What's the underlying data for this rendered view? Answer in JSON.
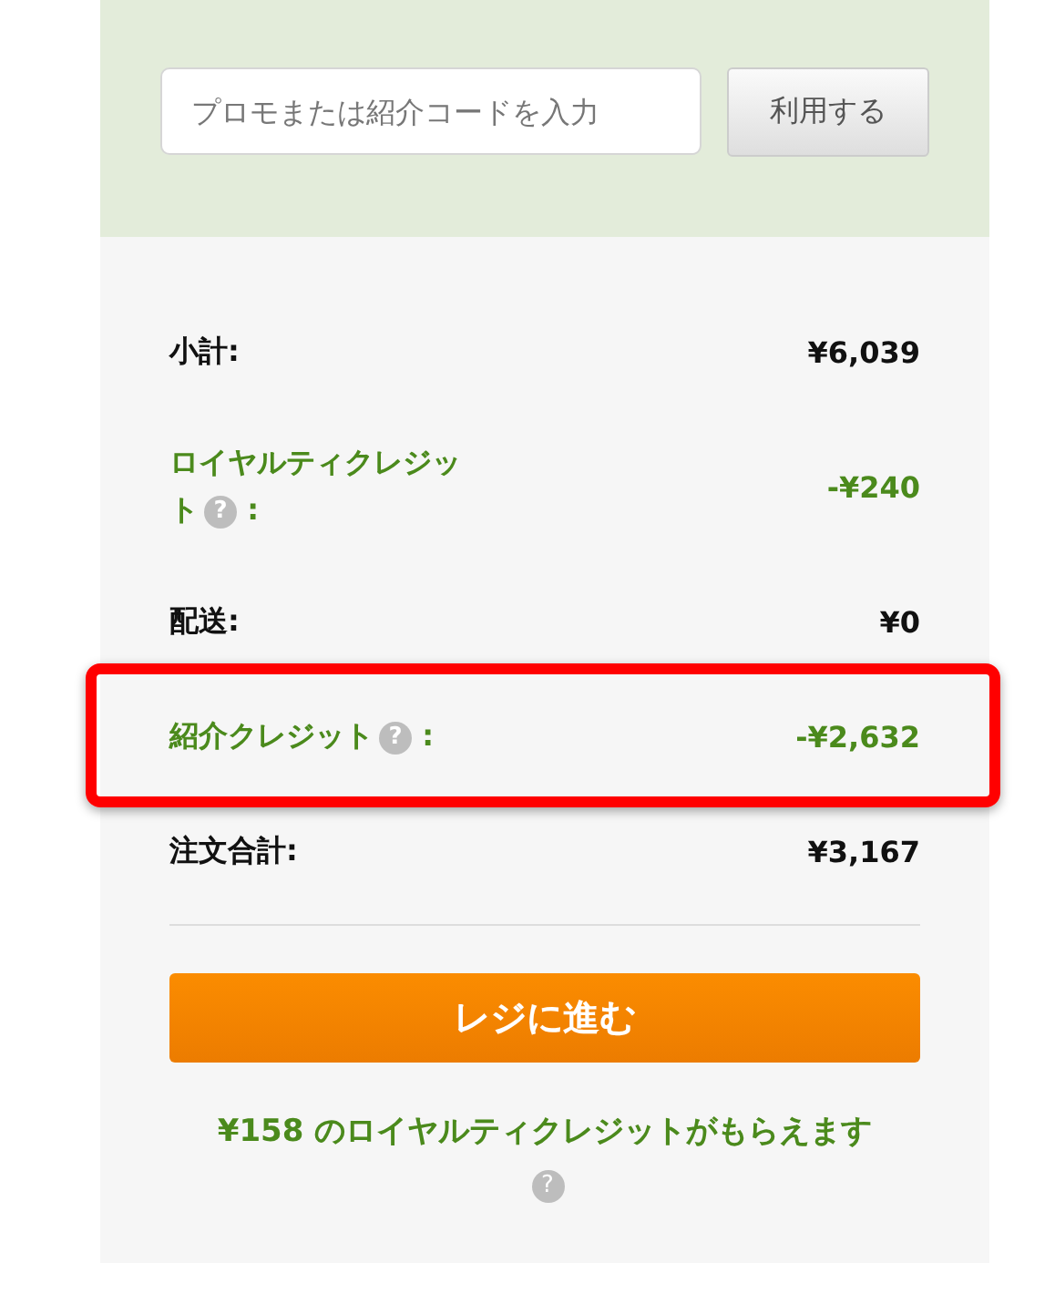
{
  "promo": {
    "placeholder": "プロモまたは紹介コードを入力",
    "button": "利用する"
  },
  "rows": [
    {
      "label": "小計:",
      "value": "¥6,039",
      "kind": "normal",
      "highlighted": false
    },
    {
      "label": "ロイヤルティクレジット",
      "help": "?",
      "suffix": ":",
      "value": "-¥240",
      "kind": "credit",
      "highlighted": false
    },
    {
      "label": "配送:",
      "value": "¥0",
      "kind": "normal",
      "highlighted": false
    },
    {
      "label": "紹介クレジット",
      "help": "?",
      "suffix": ":",
      "value": "-¥2,632",
      "kind": "credit",
      "highlighted": true
    },
    {
      "label": "注文合計:",
      "value": "¥3,167",
      "kind": "normal",
      "highlighted": false
    }
  ],
  "checkout_button": "レジに進む",
  "reward_note": "¥158 のロイヤルティクレジットがもらえます",
  "reward_help": "?"
}
